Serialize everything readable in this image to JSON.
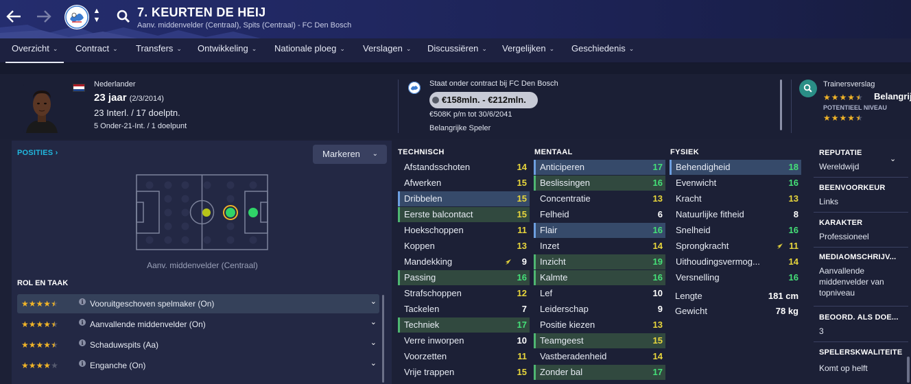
{
  "header": {
    "title": "7. KEURTEN DE HEIJ",
    "subtitle": "Aanv. middenvelder (Centraal), Spits (Centraal) - FC Den Bosch",
    "back_icon": "arrow-left-icon",
    "forward_icon": "arrow-right-icon",
    "search_icon": "search-icon"
  },
  "tabs": [
    {
      "label": "Overzicht",
      "active": true
    },
    {
      "label": "Contract"
    },
    {
      "label": "Transfers"
    },
    {
      "label": "Ontwikkeling"
    },
    {
      "label": "Nationale ploeg"
    },
    {
      "label": "Verslagen"
    },
    {
      "label": "Discussiëren"
    },
    {
      "label": "Vergelijken"
    },
    {
      "label": "Geschiedenis"
    }
  ],
  "profile": {
    "nationality": "Nederlander",
    "age": "23 jaar",
    "dob": "(2/3/2014)",
    "caps": "23 Interl. / 17 doelptn.",
    "u21": "5 Onder-21-Int. / 1 doelpunt",
    "contract_club": "Staat onder contract bij FC Den Bosch",
    "value": "€158mln. - €212mln.",
    "wage": "€508K p/m tot 30/6/2041",
    "status": "Belangrijke Speler",
    "scout_label": "Trainersverslag",
    "scout_text": "Belangrijk",
    "potential_label": "POTENTIEEL NIVEAU",
    "current_stars": 4.5,
    "potential_stars": 4.5
  },
  "positions": {
    "title": "POSITIES",
    "mark_button": "Markeren",
    "caption": "Aanv. middenvelder (Centraal)"
  },
  "roles": {
    "title": "ROL EN TAAK",
    "items": [
      {
        "name": "Vooruitgeschoven spelmaker (On)",
        "stars": 4.5,
        "selected": true
      },
      {
        "name": "Aanvallende middenvelder (On)",
        "stars": 4.5
      },
      {
        "name": "Schaduwspits (Aa)",
        "stars": 4.5
      },
      {
        "name": "Enganche (On)",
        "stars": 4
      }
    ]
  },
  "attributes": {
    "technisch_title": "TECHNISCH",
    "mentaal_title": "MENTAAL",
    "fysiek_title": "FYSIEK",
    "technisch": [
      {
        "name": "Afstandsschoten",
        "value": "14",
        "c": "y"
      },
      {
        "name": "Afwerken",
        "value": "15",
        "c": "y"
      },
      {
        "name": "Dribbelen",
        "value": "15",
        "c": "y",
        "hl": "b"
      },
      {
        "name": "Eerste balcontact",
        "value": "15",
        "c": "y",
        "hl": "g"
      },
      {
        "name": "Hoekschoppen",
        "value": "11",
        "c": "y"
      },
      {
        "name": "Koppen",
        "value": "13",
        "c": "y"
      },
      {
        "name": "Mandekking",
        "value": "9",
        "c": "w",
        "flash": true
      },
      {
        "name": "Passing",
        "value": "16",
        "c": "g",
        "hl": "g"
      },
      {
        "name": "Strafschoppen",
        "value": "12",
        "c": "y"
      },
      {
        "name": "Tackelen",
        "value": "7",
        "c": "w"
      },
      {
        "name": "Techniek",
        "value": "17",
        "c": "g",
        "hl": "g"
      },
      {
        "name": "Verre inworpen",
        "value": "10",
        "c": "w"
      },
      {
        "name": "Voorzetten",
        "value": "11",
        "c": "y"
      },
      {
        "name": "Vrije trappen",
        "value": "15",
        "c": "y"
      }
    ],
    "mentaal": [
      {
        "name": "Anticiperen",
        "value": "17",
        "c": "g",
        "hl": "b"
      },
      {
        "name": "Beslissingen",
        "value": "16",
        "c": "g",
        "hl": "g"
      },
      {
        "name": "Concentratie",
        "value": "13",
        "c": "y"
      },
      {
        "name": "Felheid",
        "value": "6",
        "c": "w"
      },
      {
        "name": "Flair",
        "value": "16",
        "c": "g",
        "hl": "b"
      },
      {
        "name": "Inzet",
        "value": "14",
        "c": "y"
      },
      {
        "name": "Inzicht",
        "value": "19",
        "c": "g",
        "hl": "g"
      },
      {
        "name": "Kalmte",
        "value": "16",
        "c": "g",
        "hl": "g"
      },
      {
        "name": "Lef",
        "value": "10",
        "c": "w"
      },
      {
        "name": "Leiderschap",
        "value": "9",
        "c": "w"
      },
      {
        "name": "Positie kiezen",
        "value": "13",
        "c": "y"
      },
      {
        "name": "Teamgeest",
        "value": "15",
        "c": "y",
        "hl": "g"
      },
      {
        "name": "Vastberadenheid",
        "value": "14",
        "c": "y"
      },
      {
        "name": "Zonder bal",
        "value": "17",
        "c": "g",
        "hl": "g"
      }
    ],
    "fysiek": [
      {
        "name": "Behendigheid",
        "value": "18",
        "c": "g",
        "hl": "b"
      },
      {
        "name": "Evenwicht",
        "value": "16",
        "c": "g"
      },
      {
        "name": "Kracht",
        "value": "13",
        "c": "y"
      },
      {
        "name": "Natuurlijke fitheid",
        "value": "8",
        "c": "w"
      },
      {
        "name": "Snelheid",
        "value": "16",
        "c": "g"
      },
      {
        "name": "Sprongkracht",
        "value": "11",
        "c": "y",
        "flash": true
      },
      {
        "name": "Uithoudingsvermog...",
        "value": "14",
        "c": "y"
      },
      {
        "name": "Versnelling",
        "value": "16",
        "c": "g"
      }
    ],
    "length_label": "Lengte",
    "length_value": "181 cm",
    "weight_label": "Gewicht",
    "weight_value": "78 kg"
  },
  "info": {
    "reputatie_h": "REPUTATIE",
    "reputatie_v": "Wereldwijd",
    "voet_h": "BEENVOORKEUR",
    "voet_v": "Links",
    "karakter_h": "KARAKTER",
    "karakter_v": "Professioneel",
    "media_h": "MEDIAOMSCHRIJV...",
    "media_v": "Aanvallende middenvelder van topniveau",
    "beoord_h": "BEOORD. ALS DOE...",
    "beoord_v": "3",
    "kwal_h": "SPELERSKWALITEITE",
    "kwal_v": "Komt op helft"
  },
  "colors": {
    "accent": "#21b8df",
    "good": "#45e078",
    "mid": "#e8d63c",
    "star": "#f0b428"
  }
}
